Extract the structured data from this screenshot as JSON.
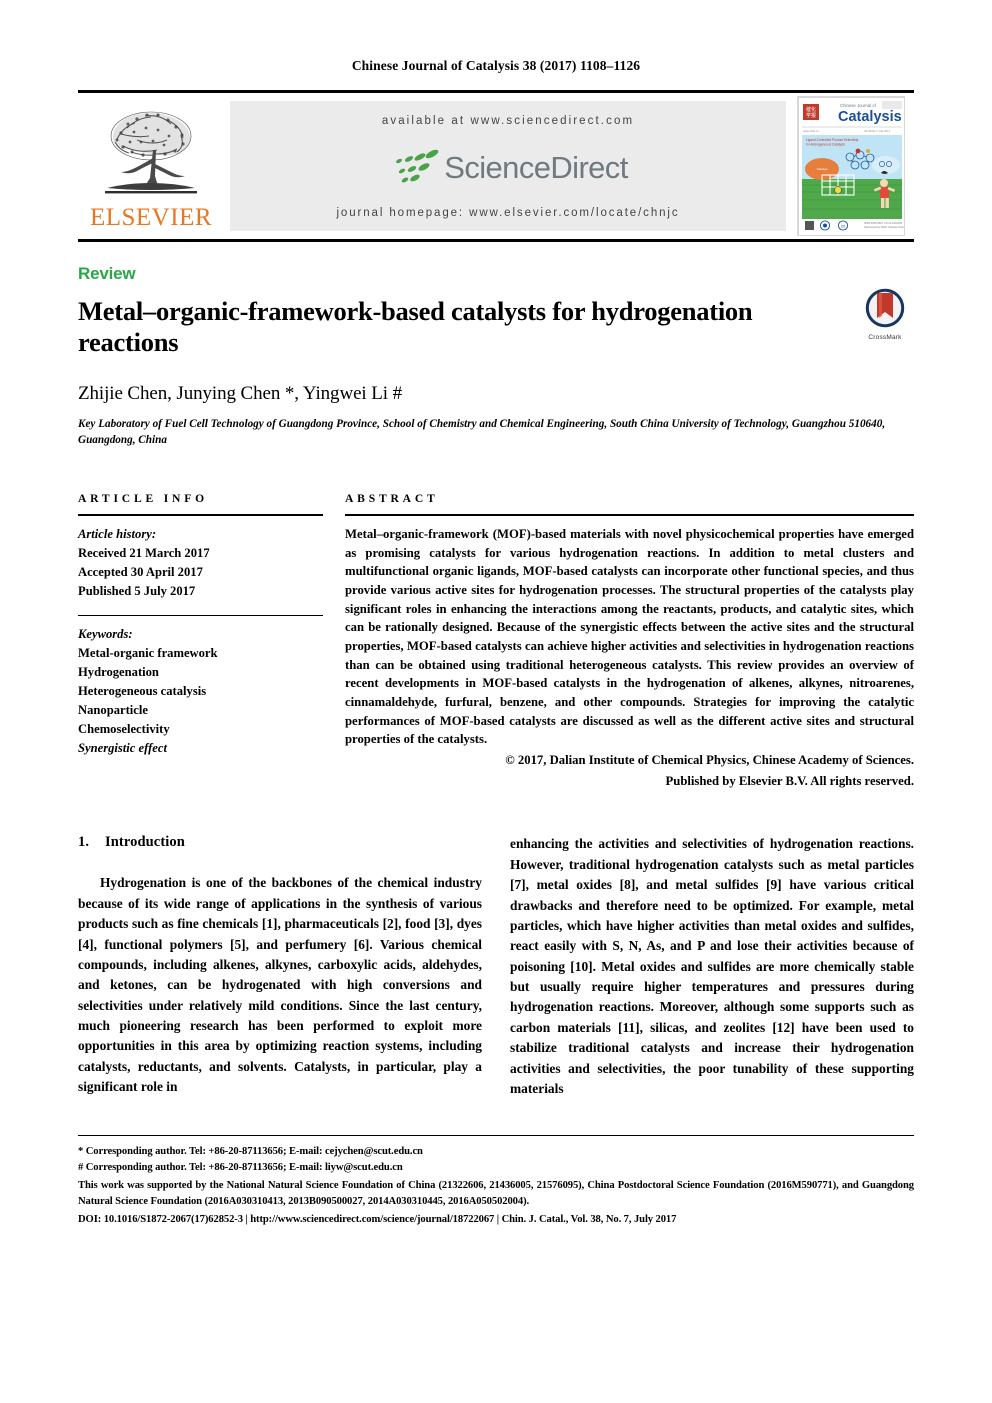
{
  "running_head": "Chinese Journal of Catalysis 38 (2017) 1108–1126",
  "masthead": {
    "publisher_wordmark": "ELSEVIER",
    "available_at": "available at www.sciencedirect.com",
    "sciencedirect_wordmark": "ScienceDirect",
    "journal_homepage": "journal homepage: www.elsevier.com/locate/chnjc",
    "cover": {
      "journal_kicker": "Chinese Journal of",
      "journal_name": "Catalysis",
      "cover_caption": "Ligand-Controlled Product Selectivity",
      "cover_caption_2": "in Heterogeneous Catalysis"
    },
    "colors": {
      "elsevier_orange": "#E87722",
      "sciencedirect_grey": "#6e7a7f",
      "sciencedirect_green": "#4aa34a",
      "panel_grey": "#ebebeb"
    }
  },
  "article": {
    "kind": "Review",
    "title": "Metal–organic-framework-based catalysts for hydrogenation reactions",
    "authors": "Zhijie Chen, Junying Chen *, Yingwei Li #",
    "affiliation": "Key Laboratory of Fuel Cell Technology of Guangdong Province, School of Chemistry and Chemical Engineering, South China University of Technology, Guangzhou 510640, Guangdong, China",
    "crossmark_label": "CrossMark",
    "kind_color": "#2aa64a"
  },
  "article_info": {
    "heading": "ARTICLE INFO",
    "history_label": "Article history:",
    "history": [
      "Received 21 March 2017",
      "Accepted 30 April 2017",
      "Published 5 July 2017"
    ],
    "keywords_label": "Keywords:",
    "keywords": [
      "Metal-organic framework",
      "Hydrogenation",
      "Heterogeneous catalysis",
      "Nanoparticle",
      "Chemoselectivity",
      "Synergistic effect"
    ]
  },
  "abstract": {
    "heading": "ABSTRACT",
    "text": "Metal–organic-framework (MOF)-based materials with novel physicochemical properties have emerged as promising catalysts for various hydrogenation reactions. In addition to metal clusters and multifunctional organic ligands, MOF-based catalysts can incorporate other functional species, and thus provide various active sites for hydrogenation processes. The structural properties of the catalysts play significant roles in enhancing the interactions among the reactants, products, and catalytic sites, which can be rationally designed. Because of the synergistic effects between the active sites and the structural properties, MOF-based catalysts can achieve higher activities and selectivities in hydrogenation reactions than can be obtained using traditional heterogeneous catalysts. This review provides an overview of recent developments in MOF-based catalysts in the hydrogenation of alkenes, alkynes, nitroarenes, cinnamaldehyde, furfural, benzene, and other compounds. Strategies for improving the catalytic performances of MOF-based catalysts are discussed as well as the different active sites and structural properties of the catalysts.",
    "copyright_line_1": "© 2017, Dalian Institute of Chemical Physics, Chinese Academy of Sciences.",
    "copyright_line_2": "Published by Elsevier B.V. All rights reserved."
  },
  "body": {
    "section_number": "1.",
    "section_title": "Introduction",
    "left_paragraph": "Hydrogenation is one of the backbones of the chemical industry because of its wide range of applications in the synthesis of various products such as fine chemicals [1], pharmaceuticals [2], food [3], dyes [4], functional polymers [5], and perfumery [6]. Various chemical compounds, including alkenes, alkynes, carboxylic acids, aldehydes, and ketones, can be hydrogenated with high conversions and selectivities under relatively mild conditions. Since the last century, much pioneering research has been performed to exploit more opportunities in this area by optimizing reaction systems, including catalysts, reductants, and solvents. Catalysts, in particular, play a significant role in",
    "right_paragraph": "enhancing the activities and selectivities of hydrogenation reactions. However, traditional hydrogenation catalysts such as metal particles [7], metal oxides [8], and metal sulfides [9] have various critical drawbacks and therefore need to be optimized. For example, metal particles, which have higher activities than metal oxides and sulfides, react easily with S, N, As, and P and lose their activities because of poisoning [10]. Metal oxides and sulfides are more chemically stable but usually require higher temperatures and pressures during hydrogenation reactions. Moreover, although some supports such as carbon materials [11], silicas, and zeolites [12] have been used to stabilize traditional catalysts and increase their hydrogenation activities and selectivities, the poor tunability of these supporting materials"
  },
  "footnotes": {
    "corresponding_1": "* Corresponding author. Tel: +86-20-87113656; E-mail: cejychen@scut.edu.cn",
    "corresponding_2": "# Corresponding author. Tel: +86-20-87113656; E-mail: liyw@scut.edu.cn",
    "funding": "This work was supported by the National Natural Science Foundation of China (21322606, 21436005, 21576095), China Postdoctoral Science Foundation (2016M590771), and Guangdong Natural Science Foundation (2016A030310413, 2013B090500027, 2014A030310445, 2016A050502004).",
    "doi_line": "DOI: 10.1016/S1872-2067(17)62852-3 | http://www.sciencedirect.com/science/journal/18722067 | Chin. J. Catal., Vol. 38, No. 7, July 2017"
  }
}
